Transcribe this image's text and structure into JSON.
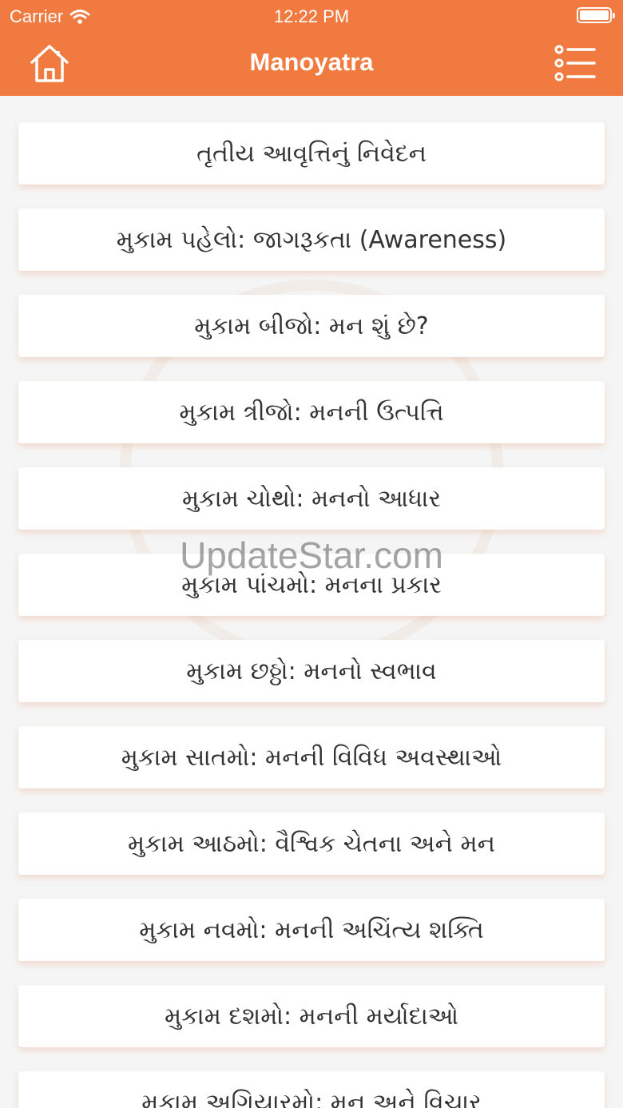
{
  "status_bar": {
    "carrier": "Carrier",
    "time": "12:22 PM"
  },
  "nav": {
    "title": "Manoyatra",
    "home_icon": "home-icon",
    "menu_icon": "list-menu-icon",
    "accent_color": "#f07a3f"
  },
  "watermark": "UpdateStar.com",
  "chapters": [
    "તૃતીય આવૃત્તિનું નિવેદન",
    "મુકામ પહેલો: જાગરૂકતા (Awareness)",
    "મુકામ બીજો: મન શું છે?",
    "મુકામ ત્રીજો: મનની ઉત્પત્તિ",
    "મુકામ ચોથો: મનનો આધાર",
    "મુકામ પાંચમો: મનના પ્રકાર",
    "મુકામ છઠ્ઠો: મનનો સ્વભાવ",
    "મુકામ સાતમો: મનની વિવિધ અવસ્થાઓ",
    "મુકામ આઠમો: વૈશ્વિક ચેતના અને મન",
    "મુકામ નવમો: મનની અચિંત્ય શક્તિ",
    "મુકામ દશમો: મનની મર્યાદાઓ",
    "મુકામ અગિયારમો: મન અને વિચાર"
  ]
}
